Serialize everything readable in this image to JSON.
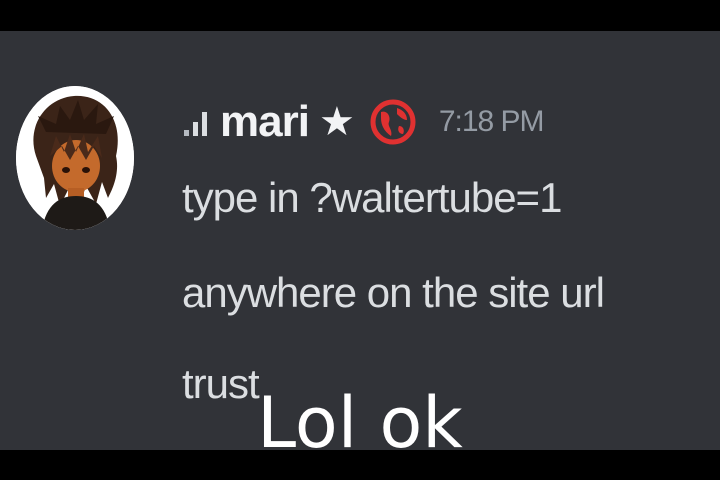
{
  "message": {
    "author": {
      "name": "mari",
      "badge_icon": "star-icon",
      "role_icon": "globe-icon",
      "role_color": "#e03131",
      "signal_icon": "signal-bars-icon"
    },
    "timestamp": "7:18 PM",
    "lines": [
      "type in ?waltertube=1",
      "anywhere on the site url",
      "trust"
    ]
  },
  "caption": "Lol ok",
  "colors": {
    "chat_background": "#313338",
    "username": "#f2f3f5",
    "message_text": "#dbdee1",
    "timestamp": "#949ba4",
    "caption": "#ffffff"
  }
}
